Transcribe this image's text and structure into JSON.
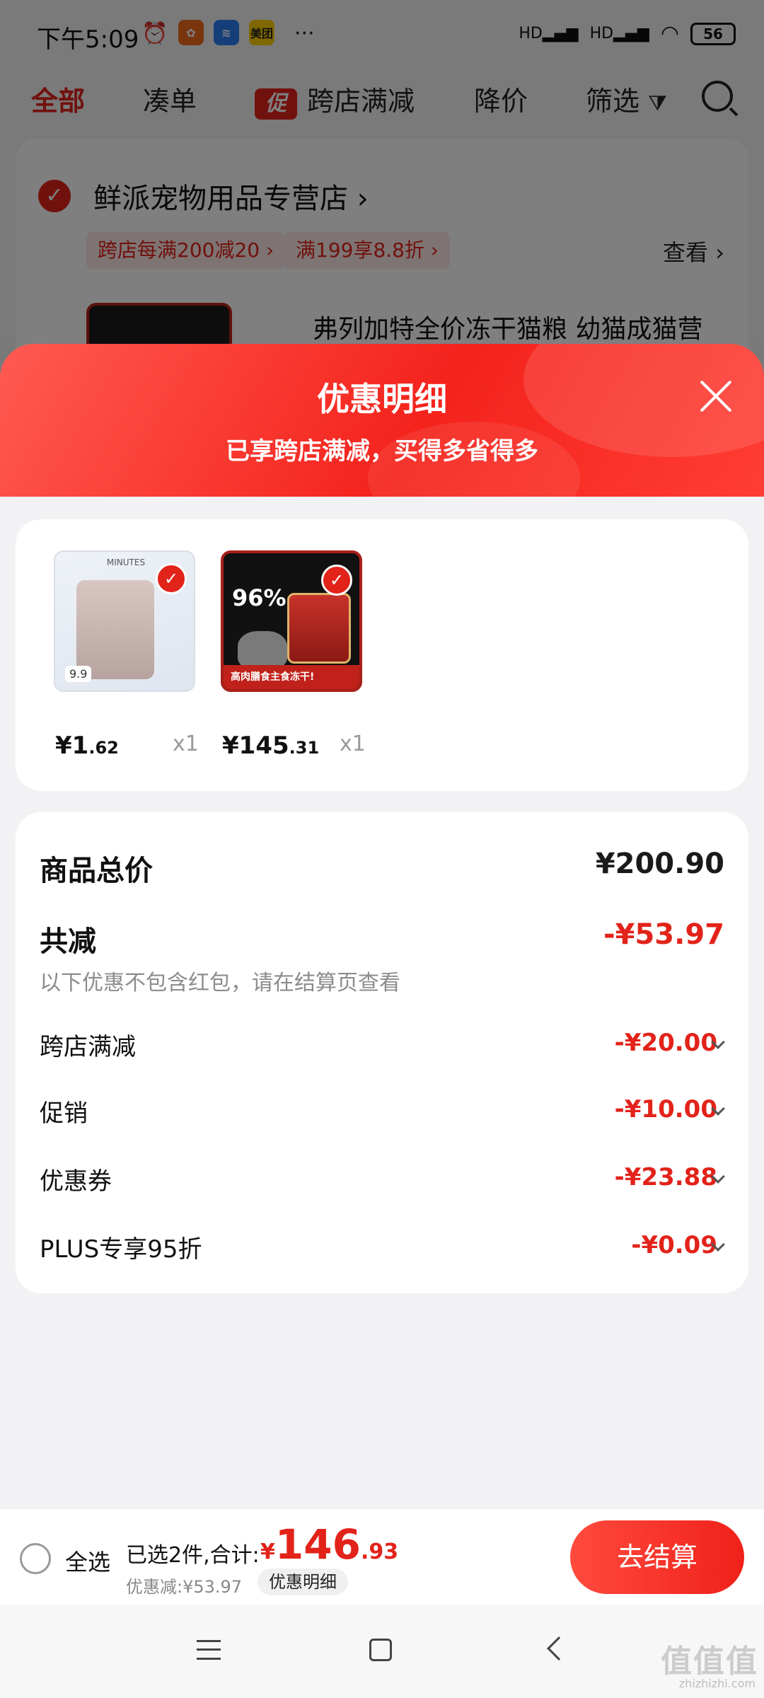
{
  "status_bar": {
    "time": "下午5:09",
    "app_icons": [
      "alarm-icon",
      "app-icon-orange",
      "app-icon-blue",
      "美团"
    ],
    "more": "···",
    "signal_1": "HD",
    "signal_2": "HD",
    "battery": "56"
  },
  "top_tabs": {
    "all": "全部",
    "bundle": "凑单",
    "promo_badge": "促",
    "cross_store": "跨店满减",
    "price_drop": "降价",
    "filter": "筛选"
  },
  "store": {
    "name": "鲜派宠物用品专营店",
    "tag_1": "跨店每满200减20",
    "tag_2": "满199享8.8折",
    "view": "查看",
    "product_title": "弗列加特全价冻干猫粮 幼猫成猫营"
  },
  "sheet": {
    "title": "优惠明细",
    "subtitle": "已享跨店满减，买得多省得多"
  },
  "products": [
    {
      "price_int": "¥1",
      "price_dec": ".62",
      "qty": "x1",
      "badge": "9.9"
    },
    {
      "price_int": "¥145",
      "price_dec": ".31",
      "qty": "x1",
      "headline": "96%",
      "banner": "高肉膳食主食冻干!"
    }
  ],
  "summary": {
    "total_label": "商品总价",
    "total_value": "¥200.90",
    "discount_label": "共减",
    "discount_value": "-¥53.97",
    "hint": "以下优惠不包含红包，请在结算页查看",
    "items": [
      {
        "label": "跨店满减",
        "value": "-¥20.00"
      },
      {
        "label": "促销",
        "value": "-¥10.00"
      },
      {
        "label": "优惠券",
        "value": "-¥23.88"
      },
      {
        "label": "PLUS专享95折",
        "value": "-¥0.09"
      }
    ]
  },
  "bottom_bar": {
    "select_all": "全选",
    "selected_text": "已选2件,合计:",
    "total_currency": "¥",
    "total_int": "146",
    "total_dec": ".93",
    "saved_text": "优惠减:¥53.97",
    "detail_button": "优惠明细",
    "checkout_button": "去结算"
  },
  "watermark": {
    "main": "值值值",
    "sub": "zhizhizhi.com"
  },
  "colors": {
    "accent": "#e2231a",
    "sheet_bg": "#f2f2f4"
  }
}
